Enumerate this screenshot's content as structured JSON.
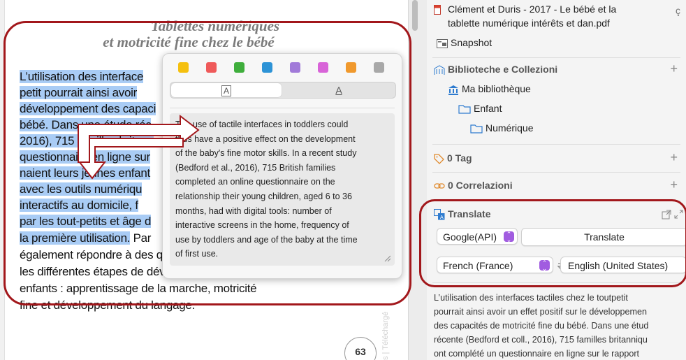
{
  "pdf": {
    "title_line1": "Tablettes numériques",
    "title_line2": "et motricité fine chez le bébé",
    "watermark": "s | Téléchargé",
    "page_number": "63",
    "lines": [
      {
        "hl": "L’utilisation des interface",
        "rest": ""
      },
      {
        "hl": "petit pourrait ainsi avoir",
        "rest": ""
      },
      {
        "hl": "développement des capaci",
        "rest": ""
      },
      {
        "hl": "bébé. Dans une étude réc",
        "rest": ""
      },
      {
        "hl": "2016), 715 familles britann",
        "rest": ""
      },
      {
        "hl": "questionnaire en ligne sur",
        "rest": ""
      },
      {
        "hl": "naient leurs jeunes enfant",
        "rest": ""
      },
      {
        "hl": "avec les outils numériqu",
        "rest": ""
      },
      {
        "hl": "interactifs au domicile, f",
        "rest": ""
      },
      {
        "hl": "par les tout-petits et âge d",
        "rest": ""
      },
      {
        "hl": "la première utilisation.",
        "rest": " Par"
      },
      {
        "hl": "",
        "rest": "également répondre à des questions portant sur"
      },
      {
        "hl": "",
        "rest": "les différentes étapes de développement de leurs"
      },
      {
        "hl": "",
        "rest": "enfants : apprentissage de la marche, motricité"
      },
      {
        "hl": "",
        "rest": "fine et développement du langage."
      }
    ]
  },
  "popup": {
    "colors": [
      "#f5c00f",
      "#ef5a5a",
      "#3fae3c",
      "#2d93d6",
      "#a17ad9",
      "#d864d8",
      "#f0992d",
      "#a8a8a8"
    ],
    "style_a": "A",
    "style_b": "A",
    "translation": [
      "The use of tactile interfaces in toddlers could",
      "thus have a positive effect on the development",
      "of the baby's fine motor skills. In a recent study",
      "(Bedford et al., 2016), 715 British families",
      "completed an online questionnaire on the",
      "relationship their young children, aged 6 to 36",
      "months, had with digital tools: number of",
      "interactive screens in the home, frequency of",
      "use by toddlers and age of the baby at the time",
      "of first use."
    ]
  },
  "panel": {
    "file_line1": "Clément et Duris - 2017 - Le bébé et la",
    "file_line2": "tablette numérique intérêts et dan.pdf",
    "snapshot": "Snapshot",
    "collections_header": "Biblioteche e Collezioni",
    "library": "Ma bibliothèque",
    "folder1": "Enfant",
    "folder2": "Numérique",
    "tags_header": "0 Tag",
    "relations_header": "0 Correlazioni",
    "translate_header": "Translate",
    "engine": "Google(API)",
    "translate_button": "Translate",
    "source_lang": "French (France)",
    "target_lang": "English (United States)",
    "plus": "+",
    "result": [
      "L’utilisation des interfaces tactiles chez le toutpetit",
      "pourrait ainsi avoir un effet positif sur le développemen",
      "des capacités de motricité fine du bébé. Dans une étud",
      "récente (Bedford et coll., 2016), 715 familles britanniqu",
      "ont complété un questionnaire en ligne sur le rapport"
    ]
  },
  "colors": {
    "annotation_red": "#a2171b",
    "highlight": "#a9ccf5",
    "accent_purple": "#a15ce0"
  }
}
